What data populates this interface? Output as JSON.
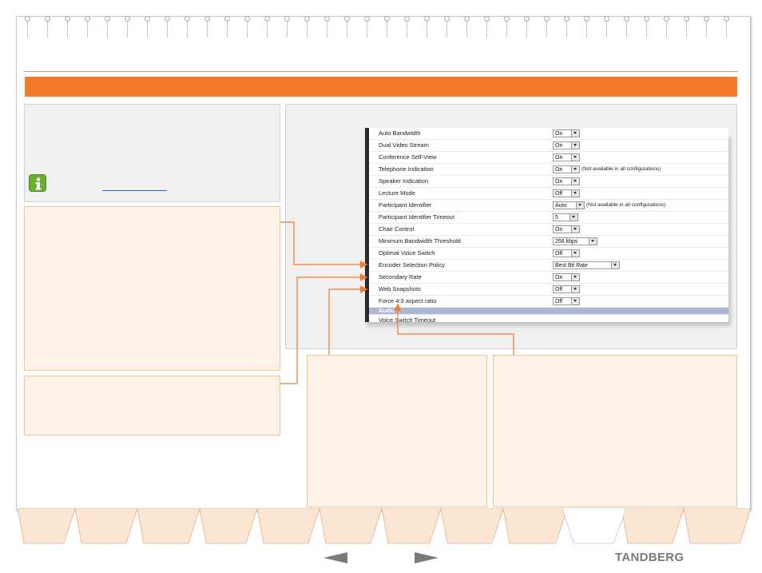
{
  "brand": {
    "name": "TANDBERG"
  },
  "info": {
    "link_text": ""
  },
  "settings": {
    "rows": [
      {
        "label": "Auto Bandwidth",
        "value": "On"
      },
      {
        "label": "Dual Video Stream",
        "value": "On"
      },
      {
        "label": "Conference Self-View",
        "value": "On"
      },
      {
        "label": "Telephone Indication",
        "value": "On",
        "note": "(Not available in all configurations)"
      },
      {
        "label": "Speaker Indication",
        "value": "On"
      },
      {
        "label": "Lecture Mode",
        "value": "Off"
      },
      {
        "label": "Participant Identifier",
        "value": "Auto",
        "note": "(Not available in all configurations)"
      },
      {
        "label": "Participant Identifier Timeout",
        "value": "5"
      },
      {
        "label": "Chair Control",
        "value": "On"
      },
      {
        "label": "Minimum Bandwidth Threshold",
        "value": "256 kbps"
      },
      {
        "label": "Optimal Voice Switch",
        "value": "Off"
      },
      {
        "label": "Encoder Selection Policy",
        "value": "Best Bit Rate"
      },
      {
        "label": "Secondary Rate",
        "value": "On"
      },
      {
        "label": "Web Snapshots",
        "value": "Off"
      },
      {
        "label": "Force 4:3 aspect ratio",
        "value": "Off"
      }
    ],
    "section": {
      "label": "Audio"
    },
    "next_row": {
      "label": "Voice Switch Timeout"
    }
  },
  "icons": {
    "info": "info-icon",
    "prev": "left-arrow-icon",
    "next": "right-arrow-icon"
  },
  "colors": {
    "accent": "#f47a2c",
    "info_green": "#6aae2f",
    "section_blue": "#aeb6d6",
    "peach": "#fdf2e8"
  }
}
